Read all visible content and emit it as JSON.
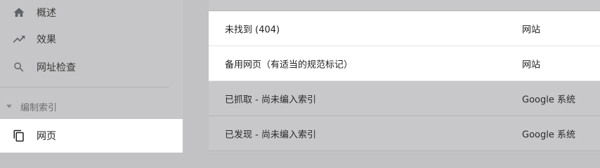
{
  "sidebar": {
    "items": [
      {
        "label": "概述",
        "icon": "home-icon"
      },
      {
        "label": "效果",
        "icon": "trending-up-icon"
      },
      {
        "label": "网址检查",
        "icon": "search-icon"
      }
    ],
    "section": {
      "label": "编制索引",
      "icon": "caret-down-icon"
    },
    "active_item": {
      "label": "网页",
      "icon": "pages-icon"
    }
  },
  "table": {
    "rows": [
      {
        "reason": "未找到 (404)",
        "source": "网站"
      },
      {
        "reason": "备用网页（有适当的规范标记）",
        "source": "网站"
      },
      {
        "reason": "已抓取 - 尚未编入索引",
        "source": "Google 系统"
      },
      {
        "reason": "已发现 - 尚未编入索引",
        "source": "Google 系统"
      }
    ]
  },
  "colors": {
    "overlay_gray": "#c4c4c6",
    "active_bg": "#ffffff",
    "icon_color": "#5f6368"
  }
}
